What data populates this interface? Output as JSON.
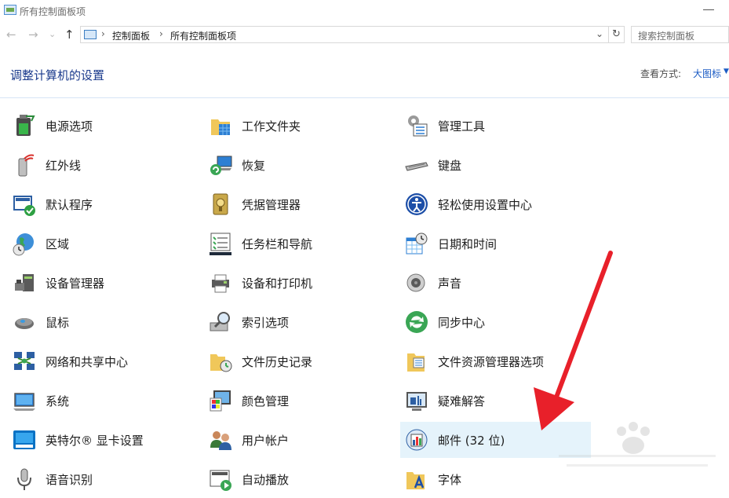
{
  "window": {
    "title": "所有控制面板项"
  },
  "navigation": {
    "back_glyph": "←",
    "forward_glyph": "→",
    "recent_glyph": "⌄",
    "up_glyph": "↑",
    "breadcrumb": [
      "控制面板",
      "所有控制面板项"
    ],
    "separator_glyph": "›",
    "dropdown_glyph": "⌄",
    "refresh_glyph": "↻",
    "search_placeholder": "搜索控制面板"
  },
  "header": {
    "title": "调整计算机的设置",
    "view_label": "查看方式:",
    "view_value": "大图标",
    "view_chevron": "▼"
  },
  "items": [
    [
      {
        "label": "电源选项",
        "icon": "battery-icon"
      },
      {
        "label": "红外线",
        "icon": "infrared-icon"
      },
      {
        "label": "默认程序",
        "icon": "default-programs-icon"
      },
      {
        "label": "区域",
        "icon": "globe-icon"
      },
      {
        "label": "设备管理器",
        "icon": "device-manager-icon"
      },
      {
        "label": "鼠标",
        "icon": "mouse-icon"
      },
      {
        "label": "网络和共享中心",
        "icon": "network-icon"
      },
      {
        "label": "系统",
        "icon": "system-icon"
      },
      {
        "label": "英特尔® 显卡设置",
        "icon": "intel-graphics-icon"
      },
      {
        "label": "语音识别",
        "icon": "microphone-icon"
      }
    ],
    [
      {
        "label": "工作文件夹",
        "icon": "work-folders-icon"
      },
      {
        "label": "恢复",
        "icon": "recovery-icon"
      },
      {
        "label": "凭据管理器",
        "icon": "credential-manager-icon"
      },
      {
        "label": "任务栏和导航",
        "icon": "taskbar-icon"
      },
      {
        "label": "设备和打印机",
        "icon": "printer-icon"
      },
      {
        "label": "索引选项",
        "icon": "indexing-icon"
      },
      {
        "label": "文件历史记录",
        "icon": "file-history-icon"
      },
      {
        "label": "颜色管理",
        "icon": "color-management-icon"
      },
      {
        "label": "用户帐户",
        "icon": "user-accounts-icon"
      },
      {
        "label": "自动播放",
        "icon": "autoplay-icon"
      }
    ],
    [
      {
        "label": "管理工具",
        "icon": "admin-tools-icon"
      },
      {
        "label": "键盘",
        "icon": "keyboard-icon"
      },
      {
        "label": "轻松使用设置中心",
        "icon": "ease-of-access-icon"
      },
      {
        "label": "日期和时间",
        "icon": "calendar-clock-icon"
      },
      {
        "label": "声音",
        "icon": "speaker-icon"
      },
      {
        "label": "同步中心",
        "icon": "sync-icon"
      },
      {
        "label": "文件资源管理器选项",
        "icon": "folder-options-icon"
      },
      {
        "label": "疑难解答",
        "icon": "troubleshooting-icon"
      },
      {
        "label": "邮件 (32 位)",
        "icon": "mail-icon",
        "selected": true
      },
      {
        "label": "字体",
        "icon": "fonts-icon"
      }
    ]
  ],
  "colors": {
    "accent": "#1a5bc4",
    "title": "#1a3a8c",
    "selection": "#e5f3fb",
    "arrow": "#e8202a"
  }
}
